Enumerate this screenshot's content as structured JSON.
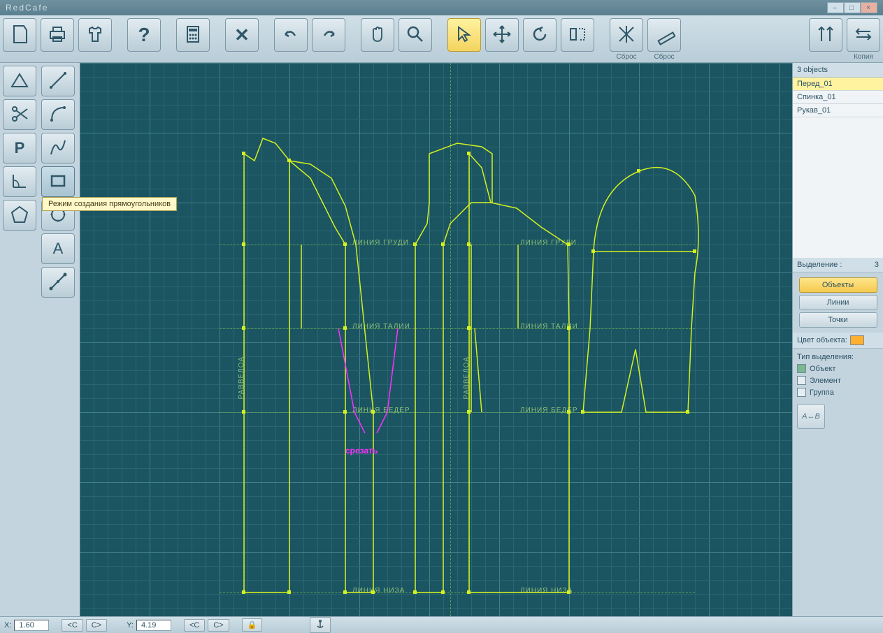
{
  "app_title": "RedCafe",
  "toolbar": {
    "reset1": "Сброс",
    "reset2": "Сброс",
    "copy": "Копия"
  },
  "tooltip": "Режим создания прямоугольников",
  "right": {
    "objects_count": "3 objects",
    "items": [
      "Перед_01",
      "Спинка_01",
      "Рукав_01"
    ],
    "selection_label": "Выделение :",
    "selection_count": "3",
    "btn_objects": "Объекты",
    "btn_lines": "Линии",
    "btn_points": "Точки",
    "color_label": "Цвет объекта:",
    "type_label": "Тип выделения:",
    "chk_object": "Объект",
    "chk_element": "Элемент",
    "chk_group": "Группа",
    "rename": "A↔B"
  },
  "canvas": {
    "chest": "ЛИНИЯ  ГРУДИ",
    "waist": "ЛИНИЯ  ТАЛИИ",
    "hip": "ЛИНИЯ  БЕДЕР",
    "hem": "ЛИНИЯ  НИЗА",
    "balance": "РАВВЕЛОА",
    "cut": "срезать"
  },
  "status": {
    "x_label": "X:",
    "x_val": "1.60",
    "y_label": "Y:",
    "y_val": "4.19",
    "lc": "<C",
    "rc": "C>"
  }
}
